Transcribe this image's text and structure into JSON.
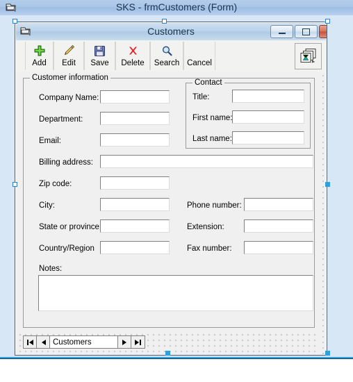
{
  "outer_window": {
    "title": "SKS - frmCustomers (Form)",
    "icon": "form-window-icon"
  },
  "form_window": {
    "title": "Customers",
    "icon": "form-window-icon",
    "controls": {
      "minimize": "minimize-icon",
      "maximize": "maximize-icon",
      "close": "×"
    }
  },
  "toolbar": {
    "buttons": [
      {
        "label": "Add",
        "icon": "plus-icon"
      },
      {
        "label": "Edit",
        "icon": "pencil-icon"
      },
      {
        "label": "Save",
        "icon": "floppy-disk-icon"
      },
      {
        "label": "Delete",
        "icon": "x-mark-icon"
      },
      {
        "label": "Search",
        "icon": "magnifier-icon"
      },
      {
        "label": "Cancel",
        "icon": ""
      }
    ],
    "special_button_icon": "stacked-windows-icon"
  },
  "customer_group": {
    "legend": "Customer information",
    "fields": [
      {
        "label": "Company Name:",
        "value": "",
        "name": "company-name"
      },
      {
        "label": "Department:",
        "value": "",
        "name": "department"
      },
      {
        "label": "Email:",
        "value": "",
        "name": "email"
      },
      {
        "label": "Billing address:",
        "value": "",
        "name": "billing-address"
      },
      {
        "label": "Zip code:",
        "value": "",
        "name": "zip-code"
      },
      {
        "label": "City:",
        "value": "",
        "name": "city"
      },
      {
        "label": "State or province:",
        "value": "",
        "name": "state-or-province"
      },
      {
        "label": "Country/Region",
        "value": "",
        "name": "country-region"
      },
      {
        "label": "Notes:",
        "value": "",
        "name": "notes"
      }
    ]
  },
  "contact_group": {
    "legend": "Contact",
    "fields": [
      {
        "label": "Title:",
        "value": "",
        "name": "title"
      },
      {
        "label": "First name:",
        "value": "",
        "name": "first-name"
      },
      {
        "label": "Last name:",
        "value": "",
        "name": "last-name"
      }
    ]
  },
  "phone_group": {
    "fields": [
      {
        "label": "Phone number:",
        "value": "",
        "name": "phone-number"
      },
      {
        "label": "Extension:",
        "value": "",
        "name": "extension"
      },
      {
        "label": "Fax number:",
        "value": "",
        "name": "fax-number"
      }
    ]
  },
  "record_navigator": {
    "first": "first-record-icon",
    "previous": "previous-record-icon",
    "label": "Customers",
    "next": "next-record-icon",
    "last": "last-record-icon"
  },
  "colors": {
    "outer_titlebar": "#a9c6e8",
    "design_surface": "#d7e7f5",
    "form_face": "#f0f0f0",
    "selection_accent": "#2f9fe0",
    "close_button": "#c3523c"
  }
}
